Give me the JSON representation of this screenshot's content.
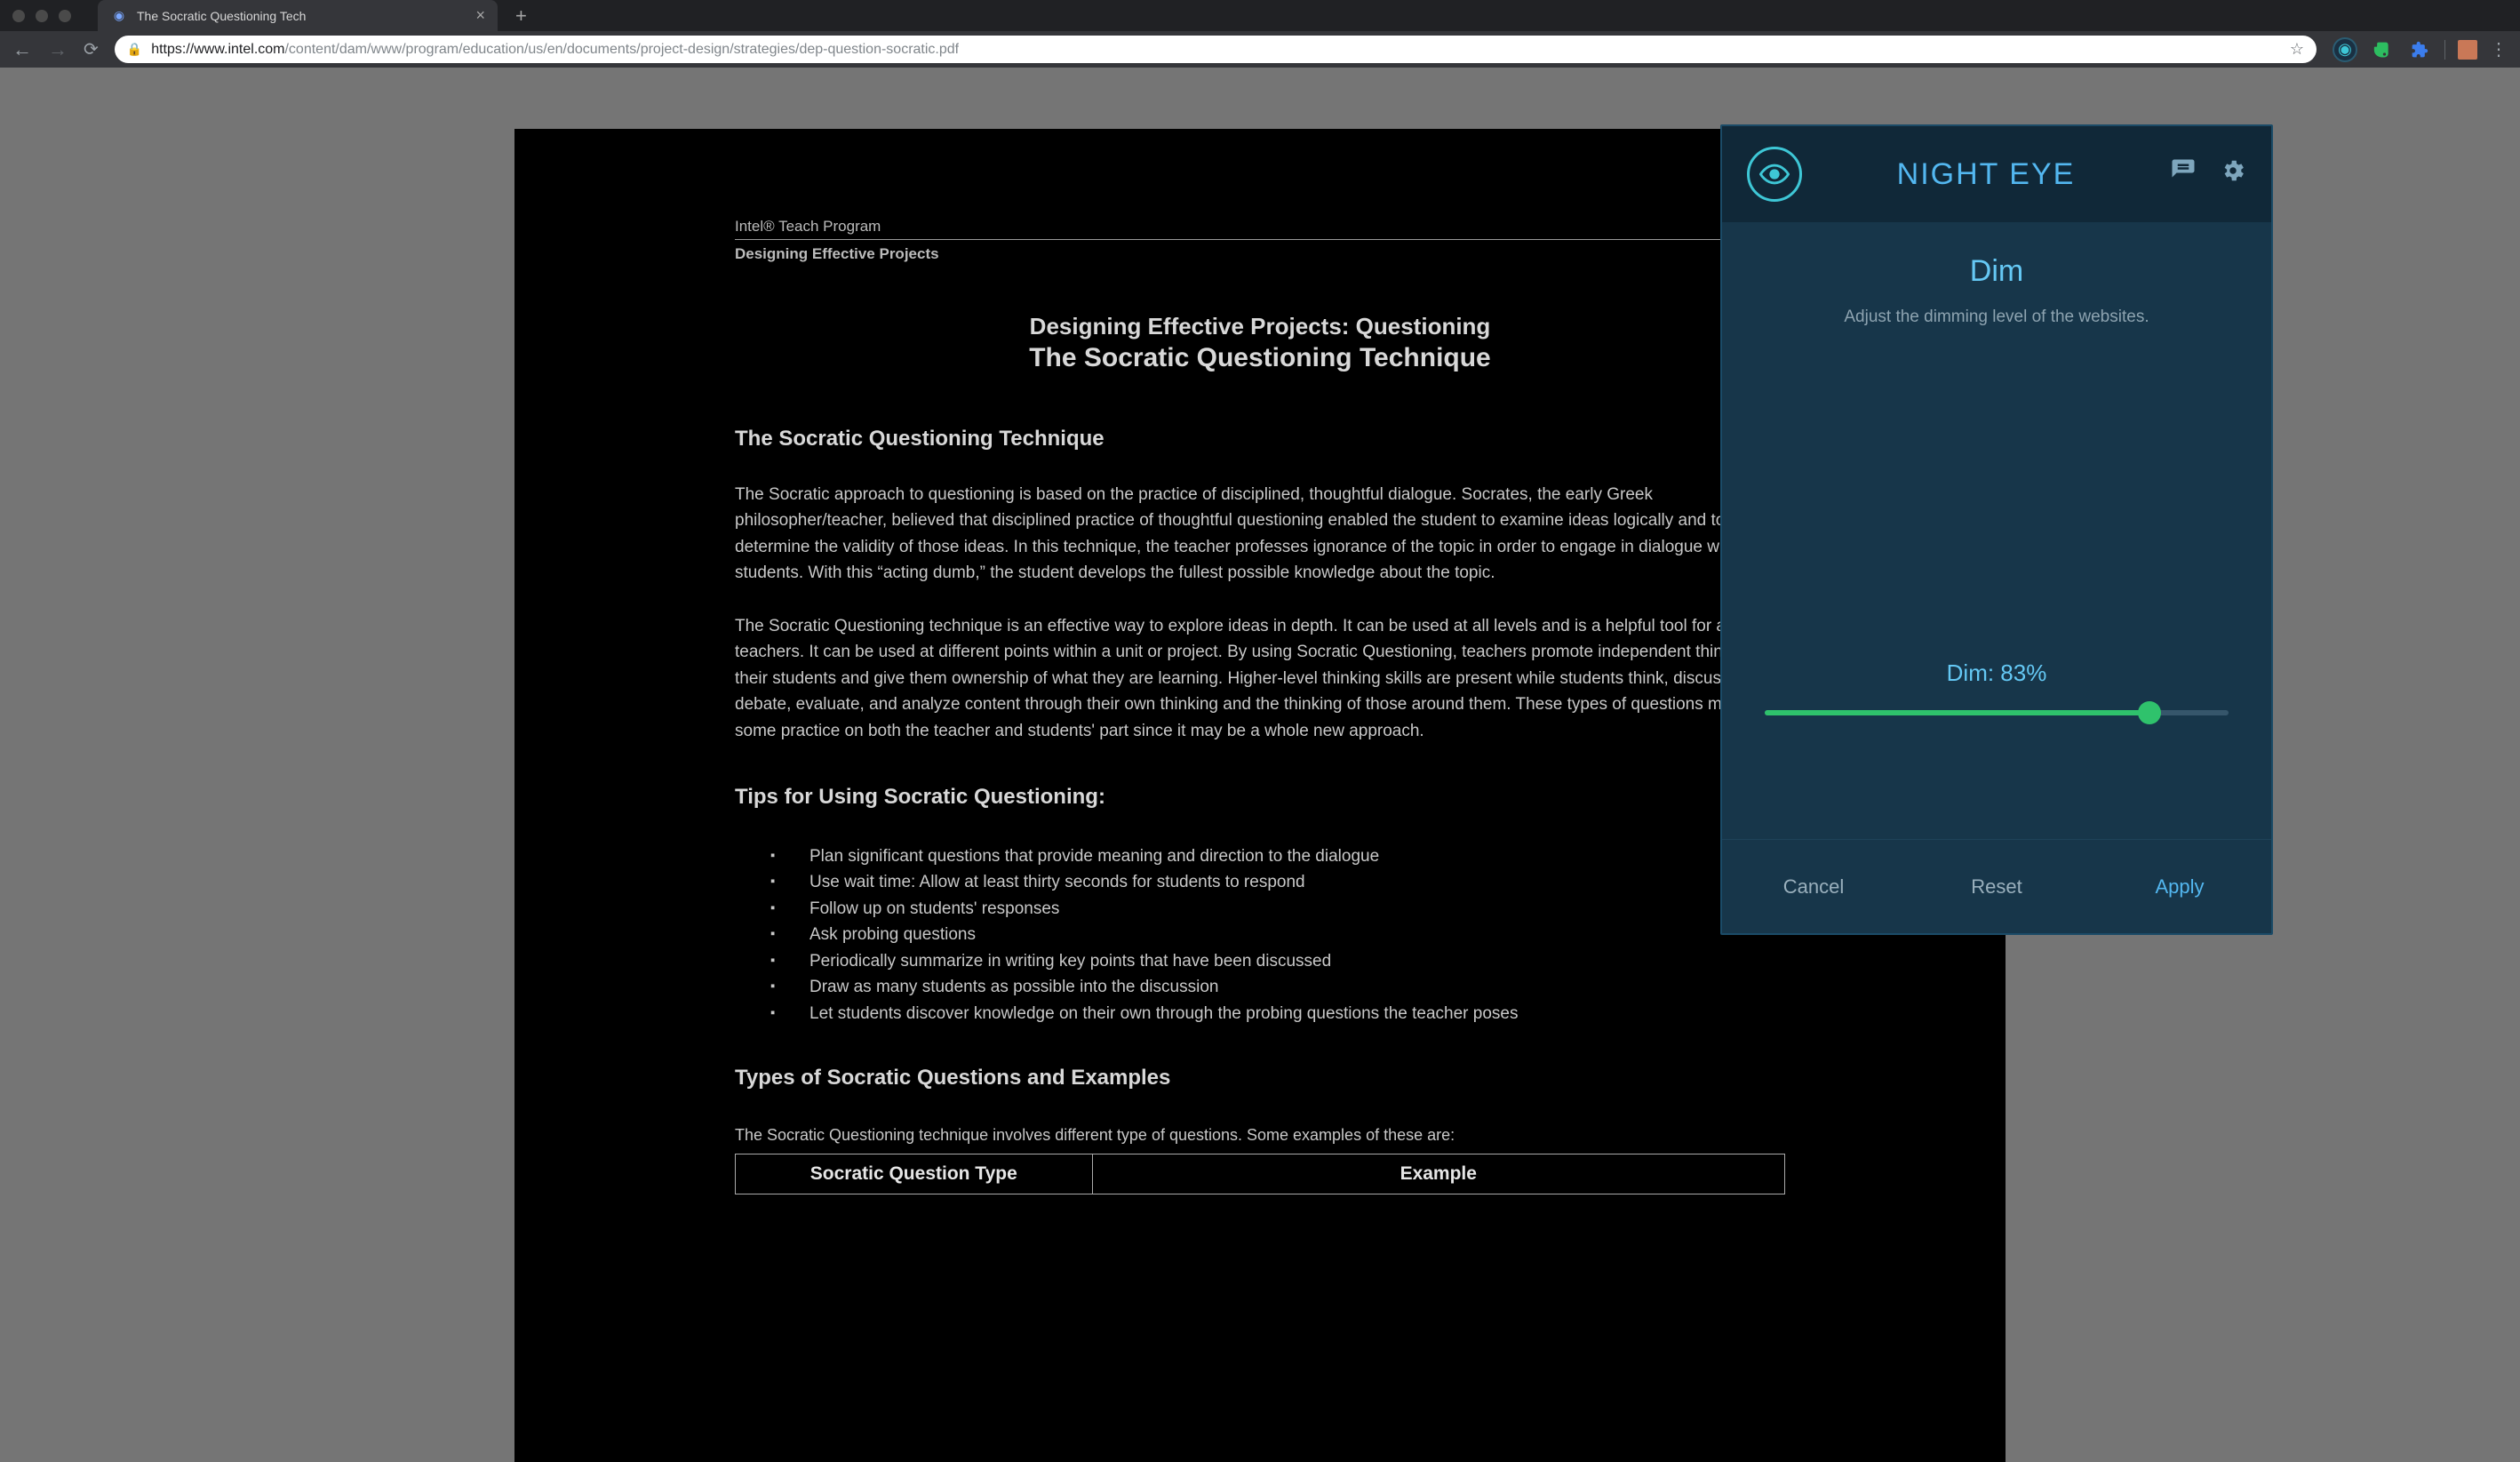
{
  "browser": {
    "tab_title": "The Socratic Questioning Tech",
    "url_secure": "https://",
    "url_host": "www.intel.com",
    "url_path": "/content/dam/www/program/education/us/en/documents/project-design/strategies/dep-question-socratic.pdf"
  },
  "document": {
    "program_line1": "Intel® Teach Program",
    "program_line2": "Designing Effective Projects",
    "pretitle": "Designing Effective Projects: Questioning",
    "maintitle": "The Socratic Questioning Technique",
    "section1_heading": "The Socratic Questioning Technique",
    "para1": "The Socratic approach to questioning is based on the practice of disciplined, thoughtful dialogue. Socrates, the early Greek philosopher/teacher, believed that disciplined practice of thoughtful questioning enabled the student to examine ideas logically and to determine the validity of those ideas. In this technique, the teacher professes ignorance of the topic in order to engage in dialogue with the students. With this “acting dumb,” the student develops the fullest possible knowledge about the topic.",
    "para2": "The Socratic Questioning technique is an effective way to explore ideas in depth. It can be used at all levels and is a helpful tool for all teachers. It can be used at different points within a unit or project. By using Socratic Questioning, teachers promote independent thinking in their students and give them ownership of what they are learning. Higher-level thinking skills are present while students think, discuss, debate, evaluate, and analyze content through their own thinking and the thinking of those around them. These types of questions may take some practice on both the teacher and students' part since it may be a whole new approach.",
    "section2_heading": "Tips for Using Socratic Questioning:",
    "tips": [
      "Plan significant questions that provide meaning and direction to the dialogue",
      "Use wait time: Allow at least thirty seconds for students to respond",
      "Follow up on students' responses",
      "Ask probing questions",
      "Periodically summarize in writing key points that have been discussed",
      "Draw as many students as possible into the discussion",
      "Let students discover knowledge on their own through the probing questions the teacher poses"
    ],
    "section3_heading": "Types of Socratic Questions and Examples",
    "table_intro": "The Socratic Questioning technique involves different type of questions. Some examples of these are:",
    "table_header1": "Socratic Question Type",
    "table_header2": "Example"
  },
  "nighteye": {
    "title": "NIGHT EYE",
    "mode": "Dim",
    "description": "Adjust the dimming level of the websites.",
    "slider_label": "Dim: 83%",
    "slider_percent": 83,
    "cancel": "Cancel",
    "reset": "Reset",
    "apply": "Apply"
  }
}
